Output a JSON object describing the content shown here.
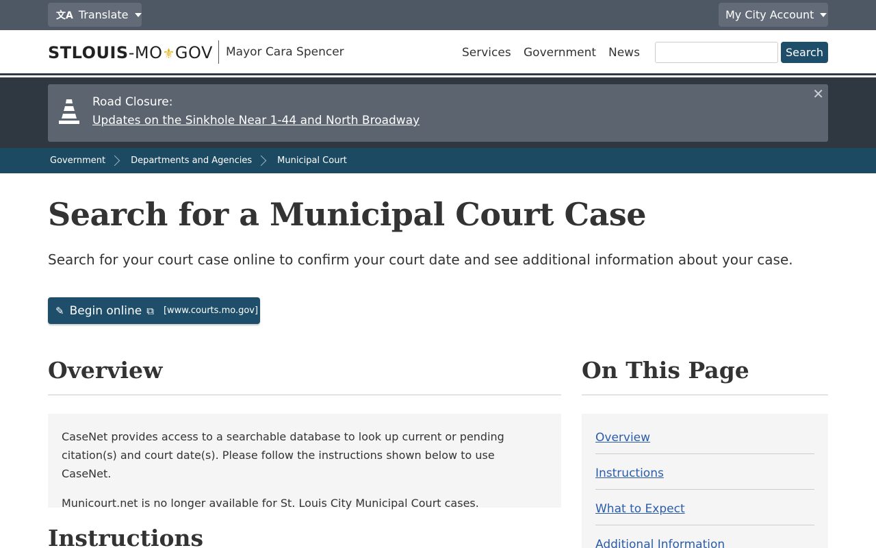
{
  "topbar": {
    "translate_label": "Translate",
    "account_label": "My City Account"
  },
  "header": {
    "logo_stlouis": "STLOUIS",
    "logo_dash": "-MO",
    "logo_gov": "GOV",
    "mayor": "Mayor Cara Spencer",
    "nav": [
      "Services",
      "Government",
      "News"
    ],
    "search_button": "Search",
    "search_placeholder": ""
  },
  "alert": {
    "title": "Road Closure:",
    "link": "Updates on the Sinkhole Near 1-44 and North Broadway",
    "close": "✕"
  },
  "breadcrumb": [
    "Government",
    "Departments and Agencies",
    "Municipal Court"
  ],
  "main": {
    "title": "Search for a Municipal Court Case",
    "lead": "Search for your court case online to confirm your court date and see additional information about your case.",
    "begin_label": "Begin online",
    "begin_url": "[www.courts.mo.gov]",
    "overview_heading": "Overview",
    "overview_p1": "CaseNet provides access to a searchable database to look up current or pending citation(s) and court date(s). Please follow the instructions shown below to use CaseNet.",
    "overview_p2": "Municourt.net is no longer available for St. Louis City Municipal Court cases.",
    "instructions_heading": "Instructions"
  },
  "sidebar": {
    "heading": "On This Page",
    "items": [
      "Overview",
      "Instructions",
      "What to Expect",
      "Additional Information"
    ]
  },
  "colors": {
    "topbar": "#4e5865",
    "primary": "#1f4e6a",
    "breadcrumb": "#1d4a63",
    "alert_band": "#2f3741",
    "link": "#2a5caa",
    "fleur": "#e8b21a"
  }
}
